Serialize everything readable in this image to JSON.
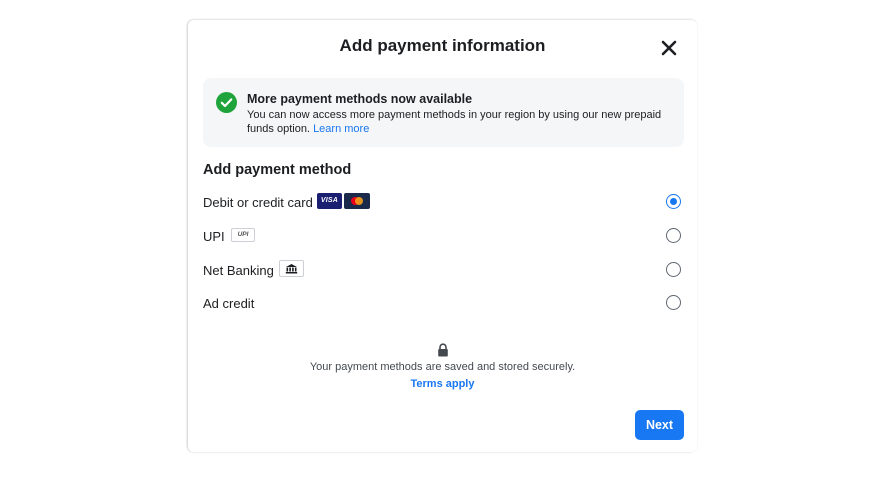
{
  "dialog": {
    "title": "Add payment information",
    "close_icon": "close-icon"
  },
  "notice": {
    "icon": "check-circle-icon",
    "title": "More payment methods now available",
    "body": "You can now access more payment methods in your region by using our new prepaid funds option.",
    "link": "Learn more"
  },
  "payment": {
    "section_title": "Add payment method",
    "selected": "card",
    "options": [
      {
        "id": "card",
        "label": "Debit or credit card",
        "badges": [
          "VISA",
          "mastercard-icon"
        ]
      },
      {
        "id": "upi",
        "label": "UPI",
        "badges": [
          "UPI"
        ]
      },
      {
        "id": "netbanking",
        "label": "Net Banking",
        "badges": [
          "bank-icon"
        ]
      },
      {
        "id": "adcredit",
        "label": "Ad credit",
        "badges": []
      }
    ]
  },
  "badges": {
    "visa": "VISA",
    "upi": "UPI"
  },
  "footer": {
    "lock_icon": "lock-icon",
    "secure_text": "Your payment methods are saved and stored securely.",
    "terms": "Terms apply",
    "next_label": "Next"
  },
  "colors": {
    "accent": "#1877f2",
    "success": "#42b72a",
    "notice_bg": "#f5f6f7"
  }
}
